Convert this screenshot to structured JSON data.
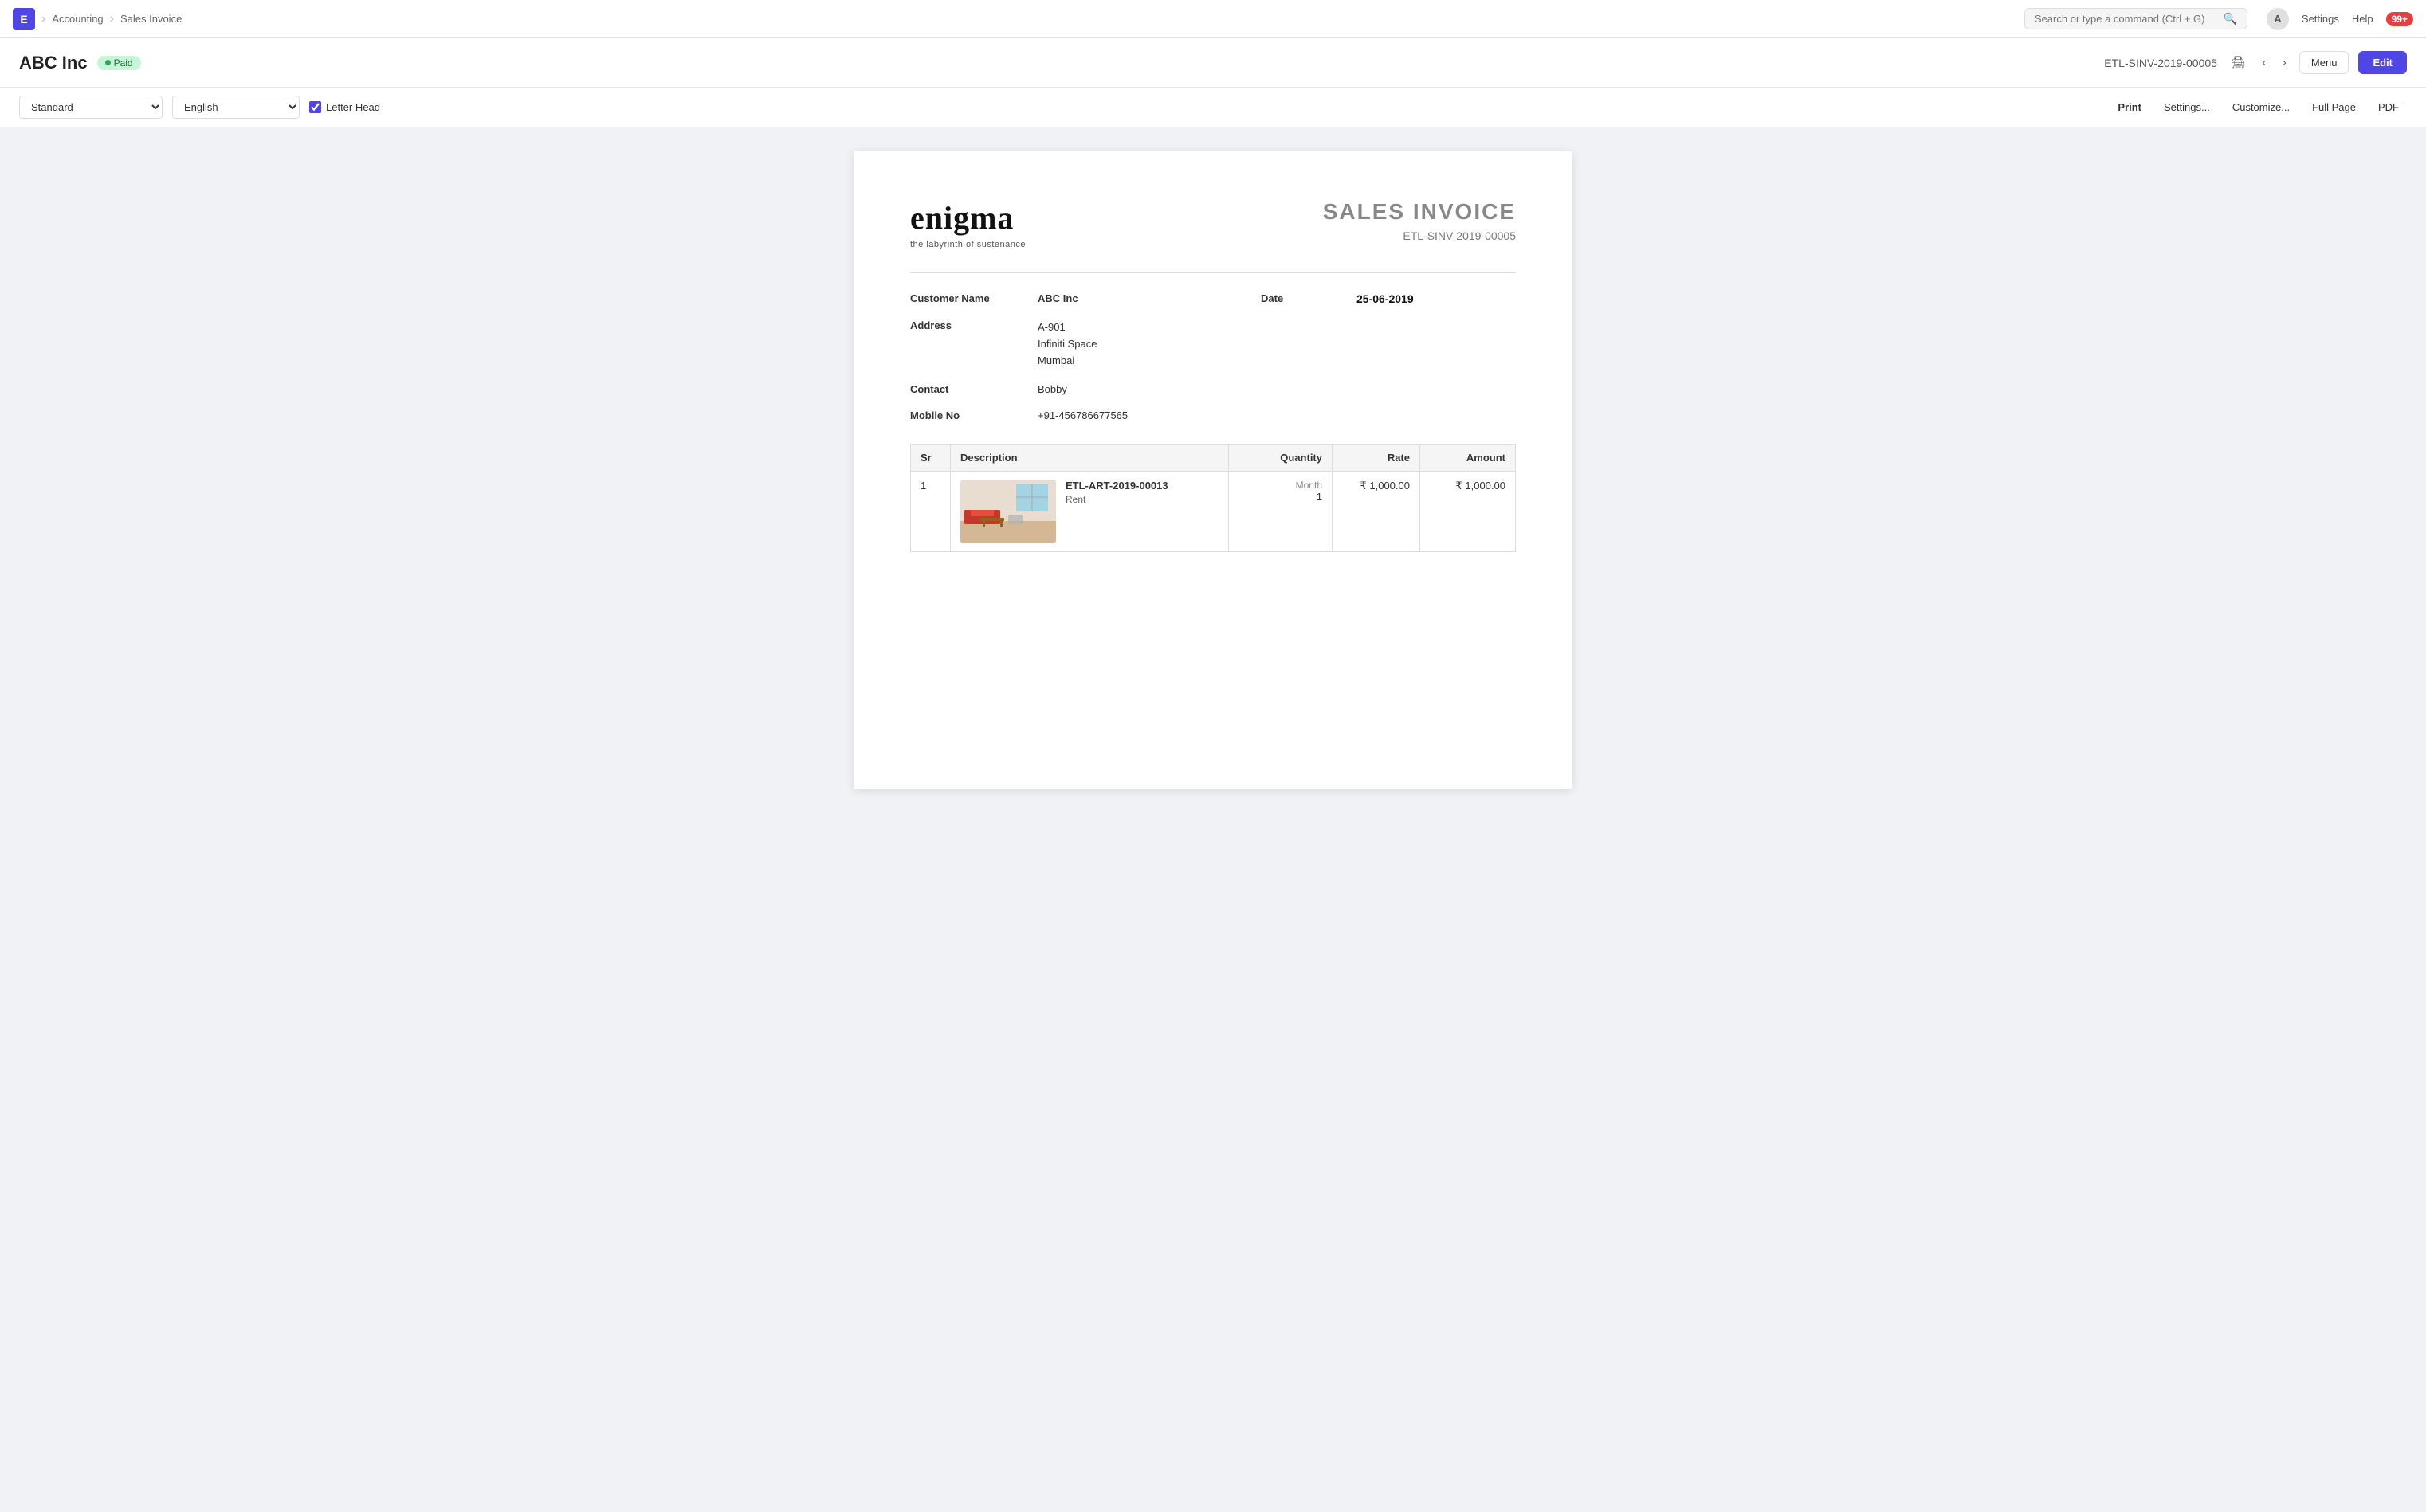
{
  "app": {
    "logo_letter": "E",
    "breadcrumbs": [
      "Accounting",
      "Sales Invoice"
    ]
  },
  "topnav": {
    "search_placeholder": "Search or type a command (Ctrl + G)",
    "avatar_letter": "A",
    "settings_label": "Settings",
    "help_label": "Help",
    "notifications_count": "99+"
  },
  "page_header": {
    "title": "ABC Inc",
    "status": "Paid",
    "doc_id": "ETL-SINV-2019-00005",
    "menu_label": "Menu",
    "edit_label": "Edit"
  },
  "toolbar": {
    "format_value": "Standard",
    "language_value": "English",
    "letterhead_label": "Letter Head",
    "letterhead_checked": true,
    "print_label": "Print",
    "settings_label": "Settings...",
    "customize_label": "Customize...",
    "fullpage_label": "Full Page",
    "pdf_label": "PDF"
  },
  "invoice": {
    "brand_name": "enigma",
    "brand_tagline": "the labyrinth of sustenance",
    "title": "SALES INVOICE",
    "invoice_number": "ETL-SINV-2019-00005",
    "customer_label": "Customer Name",
    "customer_value": "ABC Inc",
    "date_label": "Date",
    "date_value": "25-06-2019",
    "address_label": "Address",
    "address_line1": "A-901",
    "address_line2": "Infiniti Space",
    "address_line3": "Mumbai",
    "contact_label": "Contact",
    "contact_value": "Bobby",
    "mobile_label": "Mobile No",
    "mobile_value": "+91-456786677565",
    "table_headers": {
      "sr": "Sr",
      "description": "Description",
      "quantity": "Quantity",
      "rate": "Rate",
      "amount": "Amount"
    },
    "items": [
      {
        "sr": "1",
        "item_code": "ETL-ART-2019-00013",
        "description": "Rent",
        "uom": "Month",
        "quantity": "1",
        "rate": "₹ 1,000.00",
        "amount": "₹ 1,000.00"
      }
    ]
  }
}
